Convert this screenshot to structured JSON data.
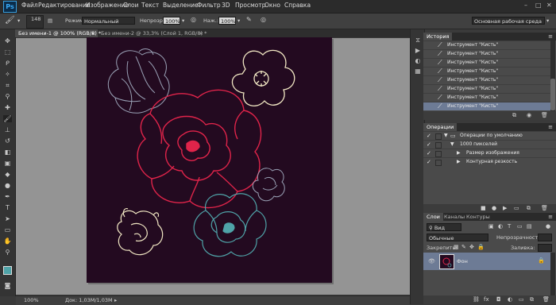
{
  "app": {
    "logo": "Ps",
    "accent": "#39a9f4"
  },
  "menu": {
    "items": [
      "Файл",
      "Редактирование",
      "Изображение",
      "Слои",
      "Текст",
      "Выделение",
      "Фильтр",
      "3D",
      "Просмотр",
      "Окно",
      "Справка"
    ]
  },
  "window_controls": {
    "minimize": "–",
    "maximize": "□",
    "close": "✕"
  },
  "options": {
    "brush_size": "148",
    "mode_label": "Режим:",
    "mode_value": "Нормальный",
    "opacity_label": "Непрозр.:",
    "opacity_value": "100%",
    "flow_label": "Наж.:",
    "flow_value": "100%",
    "workspace": "Основная рабочая среда"
  },
  "tabs": [
    {
      "label": "Без имени-1 @ 100% (RGB/8) *",
      "close": "×"
    },
    {
      "label": "Без имени-2 @ 33,3% (Слой 1, RGB/8) *",
      "close": "×"
    }
  ],
  "status": {
    "zoom": "100%",
    "doc": "Док: 1,03M/1,03M"
  },
  "history": {
    "title": "История",
    "items": [
      "Инструмент \"Кисть\"",
      "Инструмент \"Кисть\"",
      "Инструмент \"Кисть\"",
      "Инструмент \"Кисть\"",
      "Инструмент \"Кисть\"",
      "Инструмент \"Кисть\"",
      "Инструмент \"Кисть\"",
      "Инструмент \"Кисть\""
    ],
    "selected_index": 7
  },
  "actions": {
    "title": "Операции",
    "rows": [
      {
        "label": "Операции по умолчанию",
        "level": 0
      },
      {
        "label": "1000 пикселей",
        "level": 1
      },
      {
        "label": "Размер изображения",
        "level": 2
      },
      {
        "label": "Контурная резкость",
        "level": 2
      }
    ]
  },
  "layers": {
    "tabs": [
      "Слои",
      "Каналы",
      "Контуры"
    ],
    "kind_label": "Вид",
    "blend": "Обычные",
    "opacity_label": "Непрозрачность:",
    "lock_label": "Закрепить:",
    "fill_label": "Заливка:",
    "layer_name": "Фон"
  },
  "colors": {
    "canvas": "#230a20",
    "red_flower": "#e0244a",
    "cream_flower": "#f1e7c3",
    "teal_flower": "#4fa3a8",
    "grey_flower": "#9aa2b6"
  }
}
